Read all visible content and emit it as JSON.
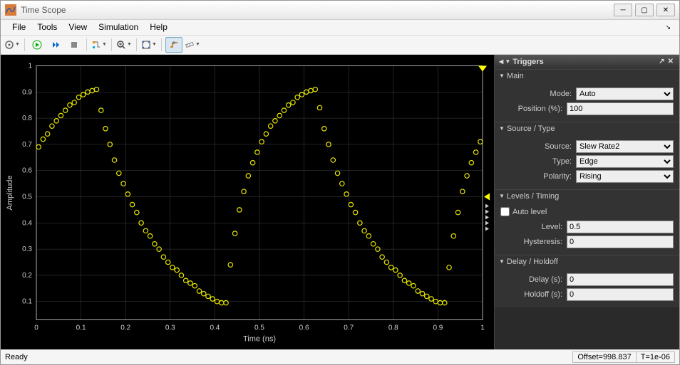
{
  "window": {
    "title": "Time Scope"
  },
  "menus": [
    "File",
    "Tools",
    "View",
    "Simulation",
    "Help"
  ],
  "triggers": {
    "title": "Triggers",
    "main": {
      "header": "Main",
      "mode_label": "Mode:",
      "mode_value": "Auto",
      "position_label": "Position (%):",
      "position_value": "100"
    },
    "source": {
      "header": "Source / Type",
      "source_label": "Source:",
      "source_value": "Slew Rate2",
      "type_label": "Type:",
      "type_value": "Edge",
      "polarity_label": "Polarity:",
      "polarity_value": "Rising"
    },
    "levels": {
      "header": "Levels / Timing",
      "auto_level_label": "Auto level",
      "level_label": "Level:",
      "level_value": "0.5",
      "hysteresis_label": "Hysteresis:",
      "hysteresis_value": "0"
    },
    "delay": {
      "header": "Delay / Holdoff",
      "delay_label": "Delay (s):",
      "delay_value": "0",
      "holdoff_label": "Holdoff (s):",
      "holdoff_value": "0"
    }
  },
  "status": {
    "ready": "Ready",
    "offset": "Offset=998.837",
    "time": "T=1e-06"
  },
  "chart_data": {
    "type": "scatter",
    "title": "",
    "xlabel": "Time (ns)",
    "ylabel": "Amplitude",
    "xlim": [
      0,
      1
    ],
    "ylim": [
      0.03,
      1.0
    ],
    "xticks": [
      0,
      0.1,
      0.2,
      0.3,
      0.4,
      0.5,
      0.6,
      0.7,
      0.8,
      0.9,
      1
    ],
    "yticks": [
      0.1,
      0.2,
      0.3,
      0.4,
      0.5,
      0.6,
      0.7,
      0.8,
      0.9,
      1
    ],
    "marker": "o",
    "color": "#e6e600",
    "grid": true,
    "x": [
      0.005,
      0.015,
      0.025,
      0.035,
      0.045,
      0.055,
      0.065,
      0.075,
      0.085,
      0.095,
      0.105,
      0.115,
      0.125,
      0.135,
      0.145,
      0.155,
      0.165,
      0.175,
      0.185,
      0.195,
      0.205,
      0.215,
      0.225,
      0.235,
      0.245,
      0.255,
      0.265,
      0.275,
      0.285,
      0.295,
      0.305,
      0.315,
      0.325,
      0.335,
      0.345,
      0.355,
      0.365,
      0.375,
      0.385,
      0.395,
      0.405,
      0.415,
      0.425,
      0.435,
      0.445,
      0.455,
      0.465,
      0.475,
      0.485,
      0.495,
      0.505,
      0.515,
      0.525,
      0.535,
      0.545,
      0.555,
      0.565,
      0.575,
      0.585,
      0.595,
      0.605,
      0.615,
      0.625,
      0.635,
      0.645,
      0.655,
      0.665,
      0.675,
      0.685,
      0.695,
      0.705,
      0.715,
      0.725,
      0.735,
      0.745,
      0.755,
      0.765,
      0.775,
      0.785,
      0.795,
      0.805,
      0.815,
      0.825,
      0.835,
      0.845,
      0.855,
      0.865,
      0.875,
      0.885,
      0.895,
      0.905,
      0.915,
      0.925,
      0.935,
      0.945,
      0.955,
      0.965,
      0.975,
      0.985,
      0.995
    ],
    "y": [
      0.69,
      0.72,
      0.74,
      0.77,
      0.79,
      0.81,
      0.83,
      0.85,
      0.86,
      0.88,
      0.89,
      0.9,
      0.905,
      0.91,
      0.83,
      0.76,
      0.7,
      0.64,
      0.59,
      0.55,
      0.51,
      0.47,
      0.44,
      0.4,
      0.37,
      0.35,
      0.32,
      0.3,
      0.27,
      0.25,
      0.23,
      0.22,
      0.2,
      0.18,
      0.17,
      0.16,
      0.14,
      0.13,
      0.12,
      0.11,
      0.1,
      0.095,
      0.095,
      0.24,
      0.36,
      0.45,
      0.52,
      0.58,
      0.63,
      0.67,
      0.71,
      0.74,
      0.77,
      0.79,
      0.81,
      0.83,
      0.85,
      0.86,
      0.88,
      0.89,
      0.9,
      0.905,
      0.91,
      0.84,
      0.76,
      0.7,
      0.64,
      0.59,
      0.55,
      0.51,
      0.47,
      0.44,
      0.4,
      0.37,
      0.35,
      0.32,
      0.3,
      0.27,
      0.25,
      0.23,
      0.22,
      0.2,
      0.18,
      0.17,
      0.16,
      0.14,
      0.13,
      0.12,
      0.11,
      0.1,
      0.095,
      0.095,
      0.23,
      0.35,
      0.44,
      0.52,
      0.58,
      0.63,
      0.67,
      0.71
    ]
  }
}
